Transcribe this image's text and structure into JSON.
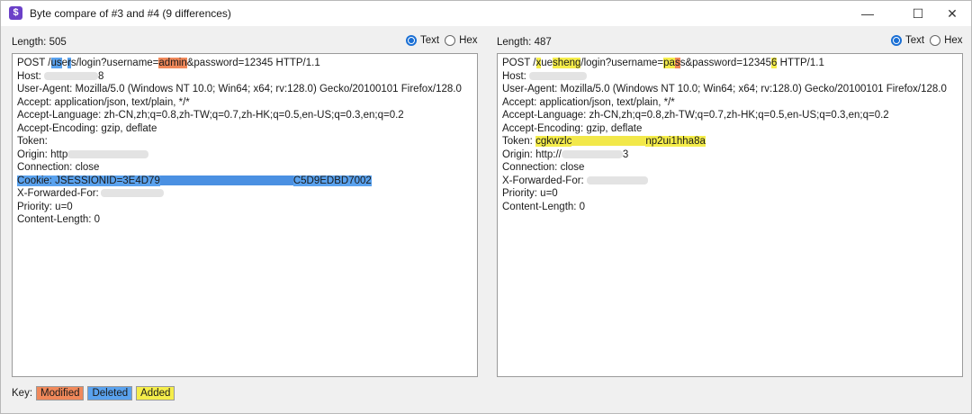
{
  "window": {
    "title": "Byte compare of #3 and #4  (9 differences)",
    "icon_glyph": "$",
    "controls": {
      "minimize": "—",
      "maximize": "☐",
      "close": "✕"
    }
  },
  "left": {
    "length_label": "Length: 505",
    "mode": {
      "text": "Text",
      "hex": "Hex",
      "selected": "Text"
    },
    "lines": {
      "l1a": "POST /",
      "l1b": "us",
      "l1c": "e",
      "l1d": "r",
      "l1e": "s/login?username=",
      "l1f": "admin",
      "l1g": "&password=12345 HTTP/1.1",
      "l2": "Host: ",
      "l2b": "8",
      "l3": "User-Agent: Mozilla/5.0 (Windows NT 10.0; Win64; x64; rv:128.0) Gecko/20100101 Firefox/128.0",
      "l4": "Accept: application/json, text/plain, */*",
      "l5": "Accept-Language: zh-CN,zh;q=0.8,zh-TW;q=0.7,zh-HK;q=0.5,en-US;q=0.3,en;q=0.2",
      "l6": "Accept-Encoding: gzip, deflate",
      "l7": "Token:",
      "l8": "Origin: http",
      "l9": "Connection: close",
      "l10a": "Cookie: JSESSIONID=3E4D79",
      "l10b": "C5D9EDBD7002",
      "l11": "X-Forwarded-For:",
      "l12": "Priority: u=0",
      "l13": "Content-Length: 0"
    }
  },
  "right": {
    "length_label": "Length: 487",
    "mode": {
      "text": "Text",
      "hex": "Hex",
      "selected": "Text"
    },
    "lines": {
      "l1a": "POST /",
      "l1b": "x",
      "l1c": "ue",
      "l1d": "sheng",
      "l1e": "/login?username=",
      "l1f": "pa",
      "l1g": "s",
      "l1h": "s",
      "l1i": "&password=12345",
      "l1j": "6",
      "l1k": " HTTP/1.1",
      "l2": "Host: ",
      "l3": "User-Agent: Mozilla/5.0 (Windows NT 10.0; Win64; x64; rv:128.0) Gecko/20100101 Firefox/128.0",
      "l4": "Accept: application/json, text/plain, */*",
      "l5": "Accept-Language: zh-CN,zh;q=0.8,zh-TW;q=0.7,zh-HK;q=0.5,en-US;q=0.3,en;q=0.2",
      "l6": "Accept-Encoding: gzip, deflate",
      "l7a": "Token: ",
      "l7b": "cgkwzlc",
      "l7c": "np2ui1hha8a",
      "l8a": "Origin: http://",
      "l8b": "3",
      "l9": "Connection: close",
      "l10": "X-Forwarded-For:",
      "l11": "Priority: u=0",
      "l12": "Content-Length: 0"
    }
  },
  "key": {
    "label": "Key:",
    "modified": "Modified",
    "deleted": "Deleted",
    "added": "Added"
  },
  "colors": {
    "modified": "#f0885a",
    "deleted": "#5aa2ee",
    "added": "#f5ed4a",
    "radio_selected": "#1a6fd4"
  }
}
